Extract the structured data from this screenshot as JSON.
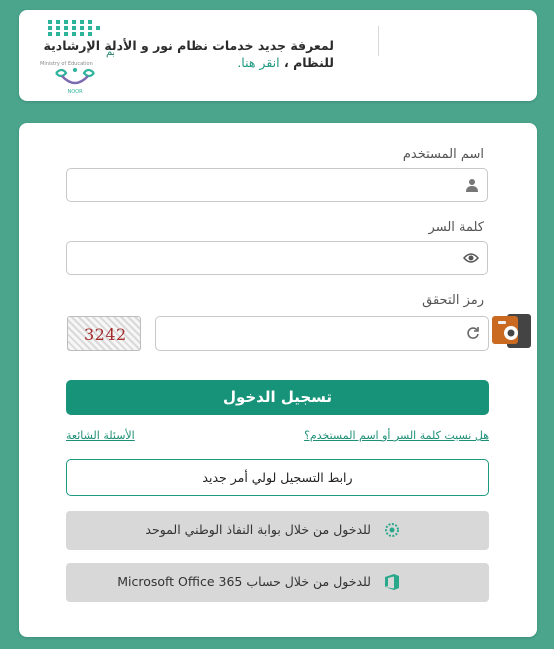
{
  "header": {
    "logo": {
      "ministry_ar": "وزارة التعليم",
      "ministry_en": "Ministry of Education",
      "brand": "NOOR"
    },
    "info_line1": "لمعرفة جديد خدمات نظام نور و الأدلة الإرشادية",
    "info_line2_prefix": "للنظام ،",
    "info_link": "انقر هنا."
  },
  "login": {
    "username_label": "اسم المستخدم",
    "password_label": "كلمة السر",
    "captcha_label": "رمز التحقق",
    "captcha_code": "3242",
    "login_button": "تسجيل الدخول",
    "forgot_link": "هل نسيت كلمة السر أو اسم المستخدم؟",
    "faq_link": "الأسئلة الشائعة",
    "parent_register": "رابط التسجيل لولي أمر جديد",
    "nafath_login": "للدخول من خلال بوابة النفاذ الوطني الموحد",
    "office_login": "للدخول من خلال حساب Microsoft Office 365"
  },
  "icons": {
    "username": "user-icon",
    "password": "eye-icon",
    "captcha_refresh": "refresh-icon",
    "nafath": "nafath-icon",
    "office": "office-icon",
    "side_widget": "camera-icon"
  },
  "colors": {
    "background": "#4aa58c",
    "primary": "#17937a",
    "link": "#1d8f76"
  }
}
